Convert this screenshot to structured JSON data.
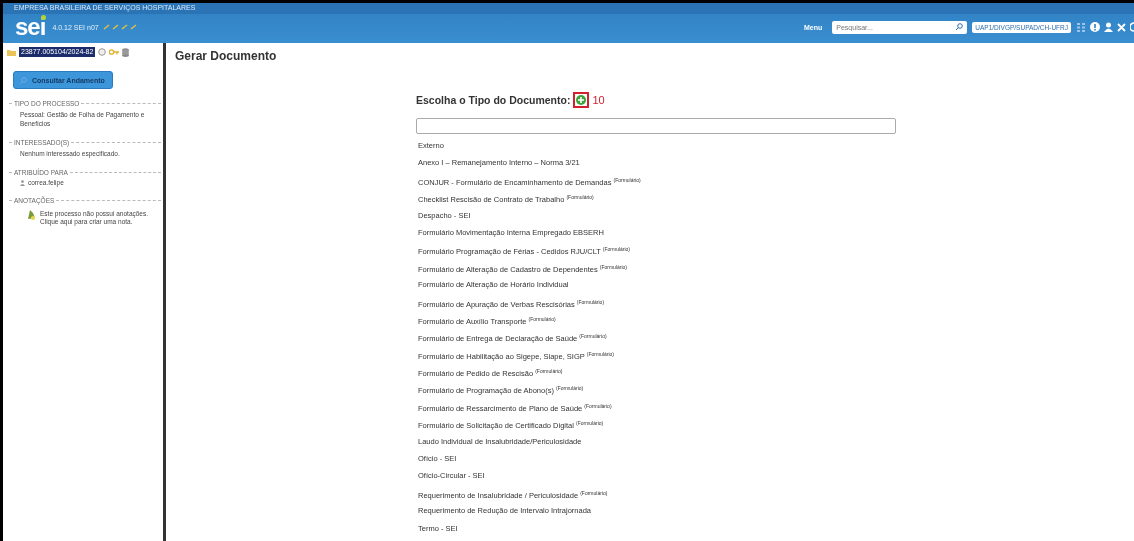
{
  "header": {
    "organization": "EMPRESA BRASILEIRA DE SERVIÇOS HOSPITALARES",
    "logo": "sei",
    "version": "4.0.12 SEI n07",
    "menu": "Menu",
    "search": {
      "placeholder": "Pesquisar..."
    },
    "unit": "UAP1/DIVGP/SUPAD/CH-UFRJ"
  },
  "sidebar": {
    "process_number": "23877.005104/2024-82",
    "button": "Consultar Andamento",
    "sections": [
      {
        "kind": "text",
        "legend": "TIPO DO PROCESSO",
        "text": "Pessoal: Gestão de Folha de Pagamento e Benefícios"
      },
      {
        "kind": "text",
        "legend": "INTERESSADO(S)",
        "text": "Nenhum interessado especificado."
      },
      {
        "kind": "user",
        "legend": "ATRIBUÍDO PARA",
        "text": "correa.felipe"
      },
      {
        "kind": "note",
        "legend": "ANOTAÇÕES",
        "text": "Este processo não possui anotações. Clique aqui para criar uma nota."
      }
    ]
  },
  "main": {
    "title": "Gerar Documento",
    "prompt": "Escolha o Tipo do Documento:",
    "callout": "10",
    "document_types": [
      "Externo",
      "Anexo I – Remanejamento Interno – Norma 3/21",
      "CONJUR - Formulário de Encaminhamento de Demandas $^{(Formulário)}$",
      "Checklist Rescisão de Contrato de Trabalho $^{(Formulário)}$",
      "Despacho - SEI",
      "Formulário Movimentação Interna Empregado EBSERH",
      "Formulário Programação de Férias - Cedidos RJU/CLT $^{(Formulário)}$",
      "Formulário de Alteração de Cadastro de Dependentes $^{(Formulário)}$",
      "Formulário de Alteração de Horário Individual",
      "Formulário de Apuração de Verbas Rescisórias $^{(Formulário)}$",
      "Formulário de Auxílio Transporte $^{(Formulário)}$",
      "Formulário de Entrega de Declaração de Saúde $^{(Formulário)}$",
      "Formulário de Habilitação ao Sigepe, Siape, SIGP $^{(Formulário)}$",
      "Formulário de Pedido de Rescisão $^{(Formulário)}$",
      "Formulário de Programação de Abono(s) $^{(Formulário)}$",
      "Formulário de Ressarcimento de Plano de Saúde $^{(Formulário)}$",
      "Formulário de Solicitação de Certificado Digital $^{(Formulário)}$",
      "Laudo Individual de Insalubridade/Periculosidade",
      "Ofício - SEI",
      "Ofício-Circular - SEI",
      "Requerimento de Insalubridade / Periculosidade $^{(Formulário)}$",
      "Requerimento de Redução de Intervalo Intrajornada",
      "Termo - SEI"
    ]
  }
}
